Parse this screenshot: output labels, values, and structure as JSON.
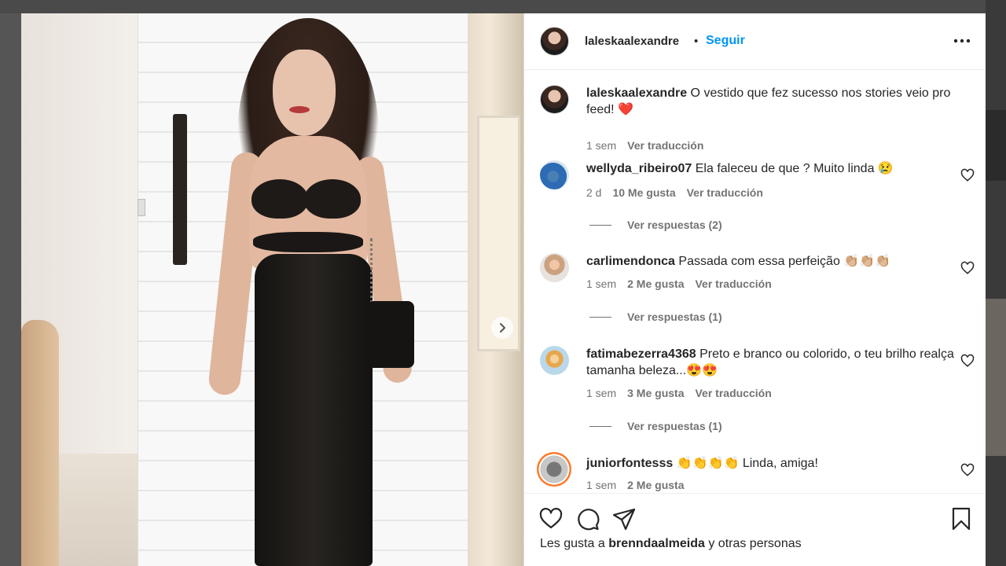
{
  "post": {
    "author": "laleskaalexandre",
    "separator": "•",
    "follow_label": "Seguir"
  },
  "caption": {
    "username": "laleskaalexandre",
    "text": "O vestido que fez sucesso nos stories veio pro feed! ❤️",
    "time": "1 sem",
    "translate": "Ver traducción"
  },
  "comments": [
    {
      "username": "wellyda_ribeiro07",
      "text": "Ela faleceu de que ? Muito linda 😢",
      "time": "2 d",
      "likes": "10 Me gusta",
      "translate": "Ver traducción",
      "replies": "Ver respuestas (2)"
    },
    {
      "username": "carlimendonca",
      "text": "Passada com essa perfeição 👏🏼👏🏼👏🏼",
      "time": "1 sem",
      "likes": "2 Me gusta",
      "translate": "Ver traducción",
      "replies": "Ver respuestas (1)"
    },
    {
      "username": "fatimabezerra4368",
      "text": "Preto e branco ou colorido, o teu brilho realça tamanha beleza...😍😍",
      "time": "1 sem",
      "likes": "3 Me gusta",
      "translate": "Ver traducción",
      "replies": "Ver respuestas (1)"
    },
    {
      "username": "juniorfontesss",
      "text": "👏👏👏👏 Linda, amiga!",
      "time": "1 sem",
      "likes": "2 Me gusta"
    }
  ],
  "likes_line": {
    "prefix": "Les gusta a",
    "user": "brenndaalmeida",
    "suffix": "y otras personas"
  },
  "icons": {
    "more": "more-options-icon",
    "like": "heart-icon",
    "comment": "comment-bubble-icon",
    "share": "send-icon",
    "save": "bookmark-icon",
    "next": "chevron-right-icon"
  },
  "colors": {
    "follow": "#0095f6",
    "text": "#262626",
    "meta": "#737373"
  }
}
